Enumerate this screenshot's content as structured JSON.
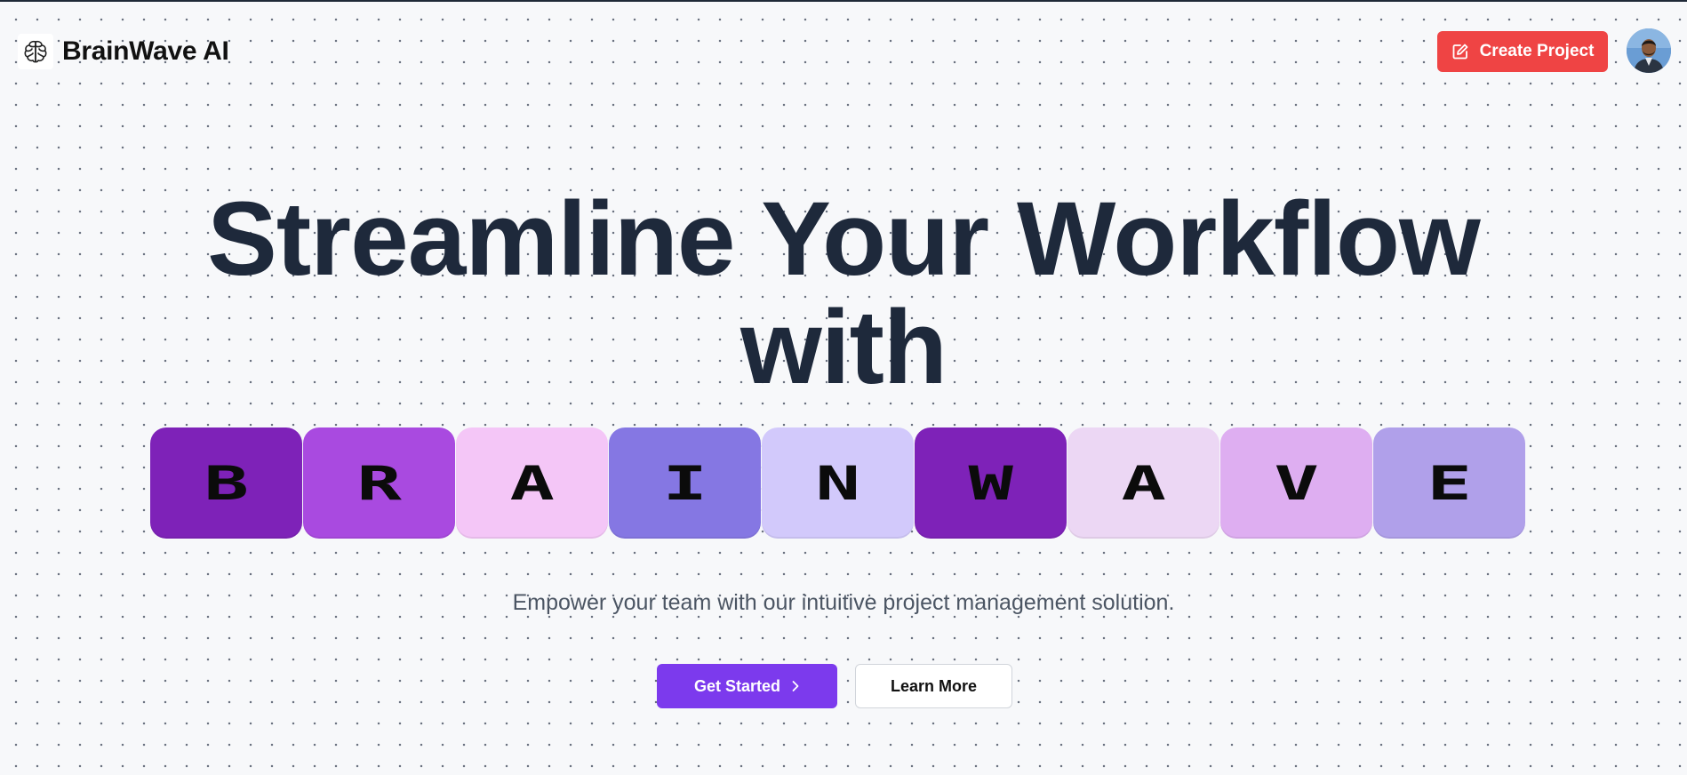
{
  "header": {
    "brand": "BrainWave AI",
    "logo_icon": "brain-icon",
    "create_button_label": "Create Project",
    "create_button_icon": "edit-icon",
    "avatar_icon": "user-avatar"
  },
  "hero": {
    "title_line1": "Streamline Your Workflow",
    "title_line2": "with",
    "tiles": [
      {
        "letter": "B",
        "color": "#7e22b8"
      },
      {
        "letter": "R",
        "color": "#a94ae0"
      },
      {
        "letter": "A",
        "color": "#f4c6f7"
      },
      {
        "letter": "I",
        "color": "#8577e3"
      },
      {
        "letter": "N",
        "color": "#d2c9fb"
      },
      {
        "letter": "W",
        "color": "#7e22b8"
      },
      {
        "letter": "A",
        "color": "#ecd7f4"
      },
      {
        "letter": "V",
        "color": "#deaef1"
      },
      {
        "letter": "E",
        "color": "#b0a0ea"
      }
    ],
    "subtitle": "Empower your team with our intuitive project management solution.",
    "primary_button": "Get Started",
    "primary_button_icon": "chevron-right-icon",
    "secondary_button": "Learn More"
  },
  "colors": {
    "background": "#f7f8fa",
    "accent_purple": "#7c3aed",
    "accent_red": "#ef4444",
    "title_color": "#1e293b"
  }
}
